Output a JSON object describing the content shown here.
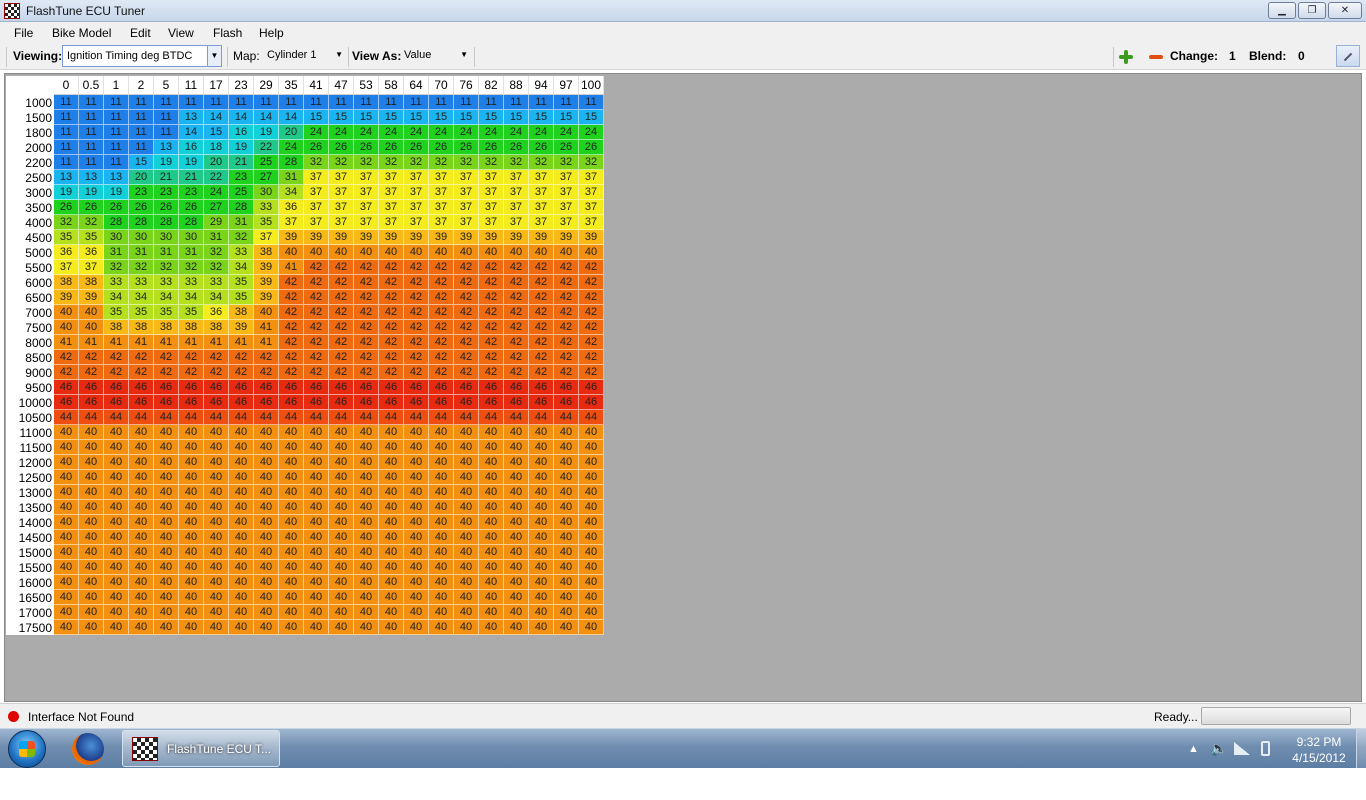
{
  "window": {
    "title": "FlashTune ECU Tuner",
    "min_label": "▁",
    "max_label": "❐",
    "close_label": "✕"
  },
  "menu": [
    "File",
    "Bike Model",
    "Edit",
    "View",
    "Flash",
    "Help"
  ],
  "toolbar": {
    "viewing_label": "Viewing:",
    "viewing_value": "Ignition Timing deg BTDC",
    "map_label": "Map:",
    "map_value": "Cylinder 1",
    "view_as_label": "View As:",
    "view_as_value": "Value",
    "change_label": "Change:",
    "change_value": "1",
    "blend_label": "Blend:",
    "blend_value": "0"
  },
  "icons": {
    "add": "plus-icon",
    "subtract": "minus-icon",
    "pin": "pin-icon",
    "status": "status-dot-icon"
  },
  "table": {
    "columns": [
      "0",
      "0.5",
      "1",
      "2",
      "5",
      "11",
      "17",
      "23",
      "29",
      "35",
      "41",
      "47",
      "53",
      "58",
      "64",
      "70",
      "76",
      "82",
      "88",
      "94",
      "97",
      "100"
    ],
    "rows": [
      {
        "rpm": "1000",
        "values": [
          11,
          11,
          11,
          11,
          11,
          11,
          11,
          11,
          11,
          11,
          11,
          11,
          11,
          11,
          11,
          11,
          11,
          11,
          11,
          11,
          11,
          11
        ]
      },
      {
        "rpm": "1500",
        "values": [
          11,
          11,
          11,
          11,
          11,
          13,
          14,
          14,
          14,
          14,
          15,
          15,
          15,
          15,
          15,
          15,
          15,
          15,
          15,
          15,
          15,
          15
        ]
      },
      {
        "rpm": "1800",
        "values": [
          11,
          11,
          11,
          11,
          11,
          14,
          15,
          16,
          19,
          20,
          24,
          24,
          24,
          24,
          24,
          24,
          24,
          24,
          24,
          24,
          24,
          24
        ]
      },
      {
        "rpm": "2000",
        "values": [
          11,
          11,
          11,
          11,
          13,
          16,
          18,
          19,
          22,
          24,
          26,
          26,
          26,
          26,
          26,
          26,
          26,
          26,
          26,
          26,
          26,
          26
        ]
      },
      {
        "rpm": "2200",
        "values": [
          11,
          11,
          11,
          15,
          19,
          19,
          20,
          21,
          25,
          28,
          32,
          32,
          32,
          32,
          32,
          32,
          32,
          32,
          32,
          32,
          32,
          32
        ]
      },
      {
        "rpm": "2500",
        "values": [
          13,
          13,
          13,
          20,
          21,
          21,
          22,
          23,
          27,
          31,
          37,
          37,
          37,
          37,
          37,
          37,
          37,
          37,
          37,
          37,
          37,
          37
        ]
      },
      {
        "rpm": "3000",
        "values": [
          19,
          19,
          19,
          23,
          23,
          23,
          24,
          25,
          30,
          34,
          37,
          37,
          37,
          37,
          37,
          37,
          37,
          37,
          37,
          37,
          37,
          37
        ]
      },
      {
        "rpm": "3500",
        "values": [
          26,
          26,
          26,
          26,
          26,
          26,
          27,
          28,
          33,
          36,
          37,
          37,
          37,
          37,
          37,
          37,
          37,
          37,
          37,
          37,
          37,
          37
        ]
      },
      {
        "rpm": "4000",
        "values": [
          32,
          32,
          28,
          28,
          28,
          28,
          29,
          31,
          35,
          37,
          37,
          37,
          37,
          37,
          37,
          37,
          37,
          37,
          37,
          37,
          37,
          37
        ]
      },
      {
        "rpm": "4500",
        "values": [
          35,
          35,
          30,
          30,
          30,
          30,
          31,
          32,
          37,
          39,
          39,
          39,
          39,
          39,
          39,
          39,
          39,
          39,
          39,
          39,
          39,
          39
        ]
      },
      {
        "rpm": "5000",
        "values": [
          36,
          36,
          31,
          31,
          31,
          31,
          32,
          33,
          38,
          40,
          40,
          40,
          40,
          40,
          40,
          40,
          40,
          40,
          40,
          40,
          40,
          40
        ]
      },
      {
        "rpm": "5500",
        "values": [
          37,
          37,
          32,
          32,
          32,
          32,
          32,
          34,
          39,
          41,
          42,
          42,
          42,
          42,
          42,
          42,
          42,
          42,
          42,
          42,
          42,
          42
        ]
      },
      {
        "rpm": "6000",
        "values": [
          38,
          38,
          33,
          33,
          33,
          33,
          33,
          35,
          39,
          42,
          42,
          42,
          42,
          42,
          42,
          42,
          42,
          42,
          42,
          42,
          42,
          42
        ]
      },
      {
        "rpm": "6500",
        "values": [
          39,
          39,
          34,
          34,
          34,
          34,
          34,
          35,
          39,
          42,
          42,
          42,
          42,
          42,
          42,
          42,
          42,
          42,
          42,
          42,
          42,
          42
        ]
      },
      {
        "rpm": "7000",
        "values": [
          40,
          40,
          35,
          35,
          35,
          35,
          36,
          38,
          40,
          42,
          42,
          42,
          42,
          42,
          42,
          42,
          42,
          42,
          42,
          42,
          42,
          42
        ]
      },
      {
        "rpm": "7500",
        "values": [
          40,
          40,
          38,
          38,
          38,
          38,
          38,
          39,
          41,
          42,
          42,
          42,
          42,
          42,
          42,
          42,
          42,
          42,
          42,
          42,
          42,
          42
        ]
      },
      {
        "rpm": "8000",
        "values": [
          41,
          41,
          41,
          41,
          41,
          41,
          41,
          41,
          41,
          42,
          42,
          42,
          42,
          42,
          42,
          42,
          42,
          42,
          42,
          42,
          42,
          42
        ]
      },
      {
        "rpm": "8500",
        "values": [
          42,
          42,
          42,
          42,
          42,
          42,
          42,
          42,
          42,
          42,
          42,
          42,
          42,
          42,
          42,
          42,
          42,
          42,
          42,
          42,
          42,
          42
        ]
      },
      {
        "rpm": "9000",
        "values": [
          42,
          42,
          42,
          42,
          42,
          42,
          42,
          42,
          42,
          42,
          42,
          42,
          42,
          42,
          42,
          42,
          42,
          42,
          42,
          42,
          42,
          42
        ]
      },
      {
        "rpm": "9500",
        "values": [
          46,
          46,
          46,
          46,
          46,
          46,
          46,
          46,
          46,
          46,
          46,
          46,
          46,
          46,
          46,
          46,
          46,
          46,
          46,
          46,
          46,
          46
        ]
      },
      {
        "rpm": "10000",
        "values": [
          46,
          46,
          46,
          46,
          46,
          46,
          46,
          46,
          46,
          46,
          46,
          46,
          46,
          46,
          46,
          46,
          46,
          46,
          46,
          46,
          46,
          46
        ]
      },
      {
        "rpm": "10500",
        "values": [
          44,
          44,
          44,
          44,
          44,
          44,
          44,
          44,
          44,
          44,
          44,
          44,
          44,
          44,
          44,
          44,
          44,
          44,
          44,
          44,
          44,
          44
        ]
      },
      {
        "rpm": "11000",
        "values": [
          40,
          40,
          40,
          40,
          40,
          40,
          40,
          40,
          40,
          40,
          40,
          40,
          40,
          40,
          40,
          40,
          40,
          40,
          40,
          40,
          40,
          40
        ]
      },
      {
        "rpm": "11500",
        "values": [
          40,
          40,
          40,
          40,
          40,
          40,
          40,
          40,
          40,
          40,
          40,
          40,
          40,
          40,
          40,
          40,
          40,
          40,
          40,
          40,
          40,
          40
        ]
      },
      {
        "rpm": "12000",
        "values": [
          40,
          40,
          40,
          40,
          40,
          40,
          40,
          40,
          40,
          40,
          40,
          40,
          40,
          40,
          40,
          40,
          40,
          40,
          40,
          40,
          40,
          40
        ]
      },
      {
        "rpm": "12500",
        "values": [
          40,
          40,
          40,
          40,
          40,
          40,
          40,
          40,
          40,
          40,
          40,
          40,
          40,
          40,
          40,
          40,
          40,
          40,
          40,
          40,
          40,
          40
        ]
      },
      {
        "rpm": "13000",
        "values": [
          40,
          40,
          40,
          40,
          40,
          40,
          40,
          40,
          40,
          40,
          40,
          40,
          40,
          40,
          40,
          40,
          40,
          40,
          40,
          40,
          40,
          40
        ]
      },
      {
        "rpm": "13500",
        "values": [
          40,
          40,
          40,
          40,
          40,
          40,
          40,
          40,
          40,
          40,
          40,
          40,
          40,
          40,
          40,
          40,
          40,
          40,
          40,
          40,
          40,
          40
        ]
      },
      {
        "rpm": "14000",
        "values": [
          40,
          40,
          40,
          40,
          40,
          40,
          40,
          40,
          40,
          40,
          40,
          40,
          40,
          40,
          40,
          40,
          40,
          40,
          40,
          40,
          40,
          40
        ]
      },
      {
        "rpm": "14500",
        "values": [
          40,
          40,
          40,
          40,
          40,
          40,
          40,
          40,
          40,
          40,
          40,
          40,
          40,
          40,
          40,
          40,
          40,
          40,
          40,
          40,
          40,
          40
        ]
      },
      {
        "rpm": "15000",
        "values": [
          40,
          40,
          40,
          40,
          40,
          40,
          40,
          40,
          40,
          40,
          40,
          40,
          40,
          40,
          40,
          40,
          40,
          40,
          40,
          40,
          40,
          40
        ]
      },
      {
        "rpm": "15500",
        "values": [
          40,
          40,
          40,
          40,
          40,
          40,
          40,
          40,
          40,
          40,
          40,
          40,
          40,
          40,
          40,
          40,
          40,
          40,
          40,
          40,
          40,
          40
        ]
      },
      {
        "rpm": "16000",
        "values": [
          40,
          40,
          40,
          40,
          40,
          40,
          40,
          40,
          40,
          40,
          40,
          40,
          40,
          40,
          40,
          40,
          40,
          40,
          40,
          40,
          40,
          40
        ]
      },
      {
        "rpm": "16500",
        "values": [
          40,
          40,
          40,
          40,
          40,
          40,
          40,
          40,
          40,
          40,
          40,
          40,
          40,
          40,
          40,
          40,
          40,
          40,
          40,
          40,
          40,
          40
        ]
      },
      {
        "rpm": "17000",
        "values": [
          40,
          40,
          40,
          40,
          40,
          40,
          40,
          40,
          40,
          40,
          40,
          40,
          40,
          40,
          40,
          40,
          40,
          40,
          40,
          40,
          40,
          40
        ]
      },
      {
        "rpm": "17500",
        "values": [
          40,
          40,
          40,
          40,
          40,
          40,
          40,
          40,
          40,
          40,
          40,
          40,
          40,
          40,
          40,
          40,
          40,
          40,
          40,
          40,
          40,
          40
        ]
      }
    ]
  },
  "colors": {
    "blue": "#1f7fe8",
    "light_blue": "#1ab4f0",
    "cyan": "#12d0d8",
    "teal_green": "#1ec98a",
    "green": "#1ed21e",
    "lime": "#7ad41a",
    "yellow_green": "#b4e01e",
    "yellow": "#f4ec1c",
    "orange_yellow": "#f8b816",
    "orange": "#f49010",
    "dark_orange": "#f06a10",
    "orange_red": "#ee4e10",
    "red": "#e82a10"
  },
  "status": {
    "message": "Interface Not Found",
    "ready": "Ready..."
  },
  "taskbar": {
    "app_label": "FlashTune ECU T...",
    "time": "9:32 PM",
    "date": "4/15/2012",
    "tray_arrow": "▲",
    "speaker": "🔈"
  }
}
